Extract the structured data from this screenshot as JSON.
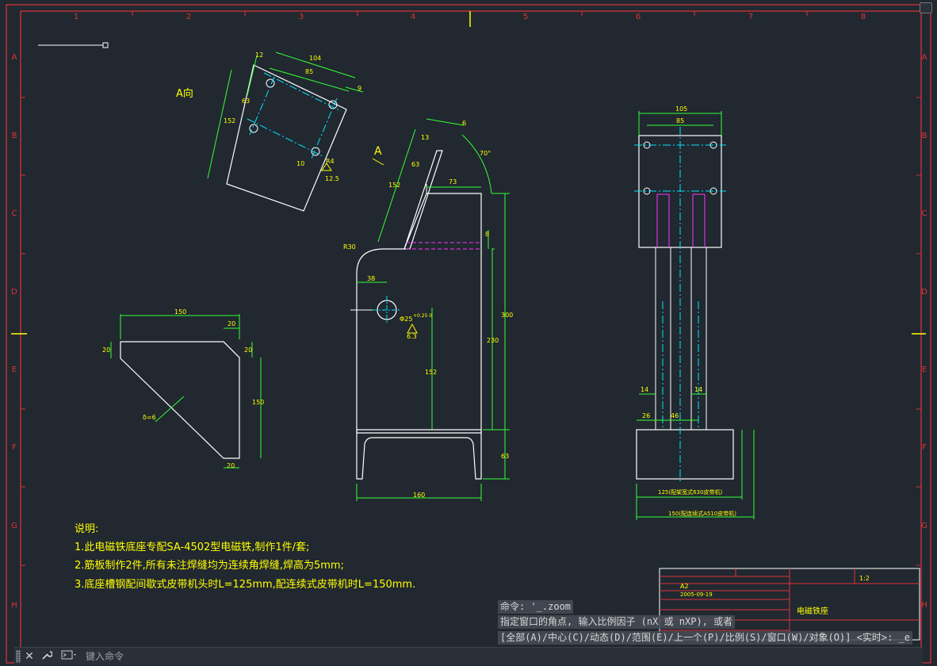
{
  "colors": {
    "background": "#212830",
    "border": "#e0323a",
    "geometry": "#ffffff",
    "dimension": "#33ff33",
    "dimension_text": "#ffff00",
    "center_line": "#00e5ff",
    "hidden_line": "#ff33ff"
  },
  "frame": {
    "columns": [
      "1",
      "2",
      "3",
      "4",
      "5",
      "6",
      "7",
      "8"
    ],
    "rows": [
      "A",
      "B",
      "C",
      "D",
      "E",
      "F",
      "G",
      "H"
    ]
  },
  "view_a": {
    "label": "A向",
    "dims": {
      "d104": "104",
      "d85": "85",
      "d12": "12",
      "d9": "9",
      "d63": "63",
      "d152": "152",
      "d10": "10",
      "r4": "R4",
      "d12_5": "12.5"
    }
  },
  "side_view": {
    "arrow_label": "A",
    "dims": {
      "d152": "152",
      "d63": "63",
      "d13": "13",
      "d6": "6",
      "angle": "70°",
      "d73": "73",
      "d8": "8",
      "r30": "R30",
      "d38": "38",
      "dia25": "Φ25",
      "tol": "+0.25\n0",
      "d6_3": "6.3",
      "d300": "300",
      "d230": "230",
      "d152b": "152",
      "d63b": "63",
      "d160": "160"
    }
  },
  "gusset": {
    "dims": {
      "d150": "150",
      "d20a": "20",
      "d20b": "20",
      "d20c": "20",
      "d150v": "150",
      "d20d": "20",
      "thk": "δ=6"
    }
  },
  "front_view": {
    "dims": {
      "d105": "105",
      "d85": "85",
      "d14a": "14",
      "d14b": "14",
      "d26": "26",
      "d46": "46",
      "d125": "125(配架宽式630皮带机)",
      "d150": "150(配连续式A510皮带机)"
    }
  },
  "notes": {
    "title": "说明:",
    "lines": [
      "1.此电磁铁底座专配SA-4502型电磁铁,制作1件/套;",
      "2.筋板制作2件,所有未注焊缝均为连续角焊缝,焊高为5mm;",
      "3.底座槽钢配间歇式皮带机头时L=125mm,配连续式皮带机时L=150mm."
    ]
  },
  "title_block": {
    "paper": "A2",
    "scale": "1:2",
    "date": "2005-09-19",
    "drawing_name": "电磁铁座"
  },
  "command": {
    "history": [
      "命令: '_.zoom",
      "指定窗口的角点, 输入比例因子 (nX 或 nXP), 或者",
      "[全部(A)/中心(C)/动态(D)/范围(E)/上一个(P)/比例(S)/窗口(W)/对象(O)] <实时>: _e"
    ],
    "placeholder": "键入命令"
  }
}
